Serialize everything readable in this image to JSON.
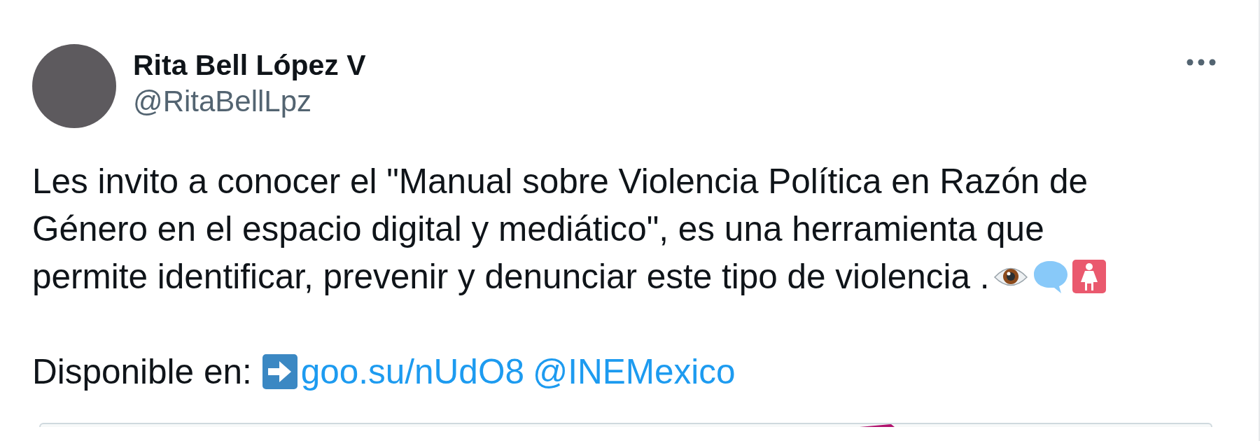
{
  "author": {
    "name": "Rita Bell López V",
    "handle": "@RitaBellLpz"
  },
  "post": {
    "text_lines": [
      "Les invito a conocer el \"Manual sobre Violencia Política en Razón de",
      "Género en el espacio digital y mediático\", es una herramienta que",
      "permite identificar, prevenir y denunciar este tipo de violencia ."
    ],
    "availability_label": "Disponible en:",
    "links": [
      "goo.su/nUdO8",
      "@INEMexico"
    ]
  }
}
